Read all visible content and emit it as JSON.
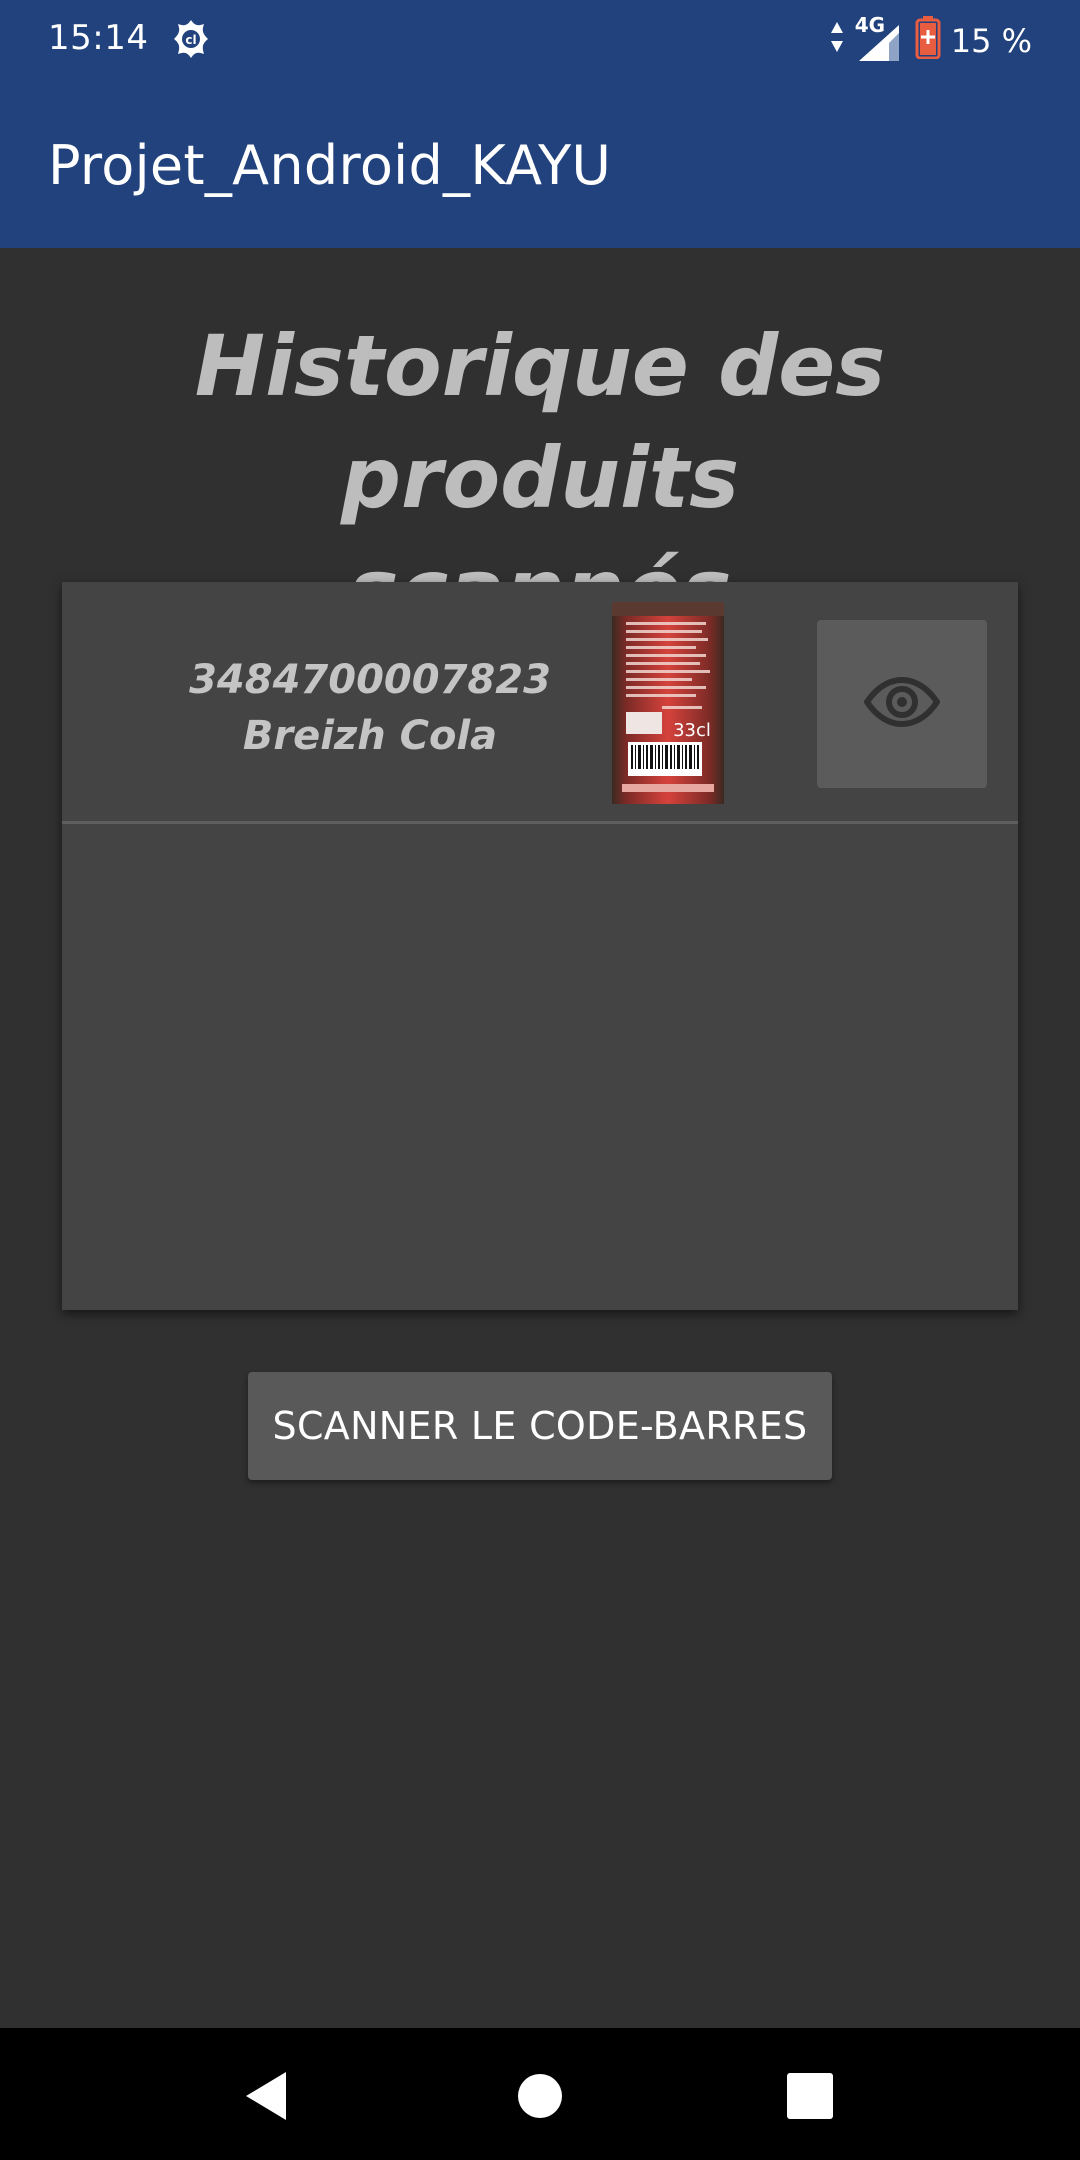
{
  "status_bar": {
    "time": "15:14",
    "network": "4G",
    "battery": "15 %",
    "icons": [
      "notification-app-icon",
      "data-transfer-icon",
      "signal-icon",
      "battery-low-icon"
    ]
  },
  "app_bar": {
    "title": "Projet_Android_KAYU"
  },
  "heading": {
    "line1": "Historique des produits",
    "line2": "scannés"
  },
  "history": {
    "items": [
      {
        "barcode": "3484700007823",
        "name": "Breizh Cola",
        "thumbnail_label": "33cl",
        "view_icon": "eye-icon"
      }
    ]
  },
  "actions": {
    "scan_label": "SCANNER LE CODE-BARRES"
  },
  "nav_bar": {
    "icons": [
      "back-icon",
      "home-icon",
      "recents-icon"
    ]
  },
  "colors": {
    "primary": "#22427d",
    "background": "#303030",
    "card": "#444444",
    "button": "#595959"
  }
}
